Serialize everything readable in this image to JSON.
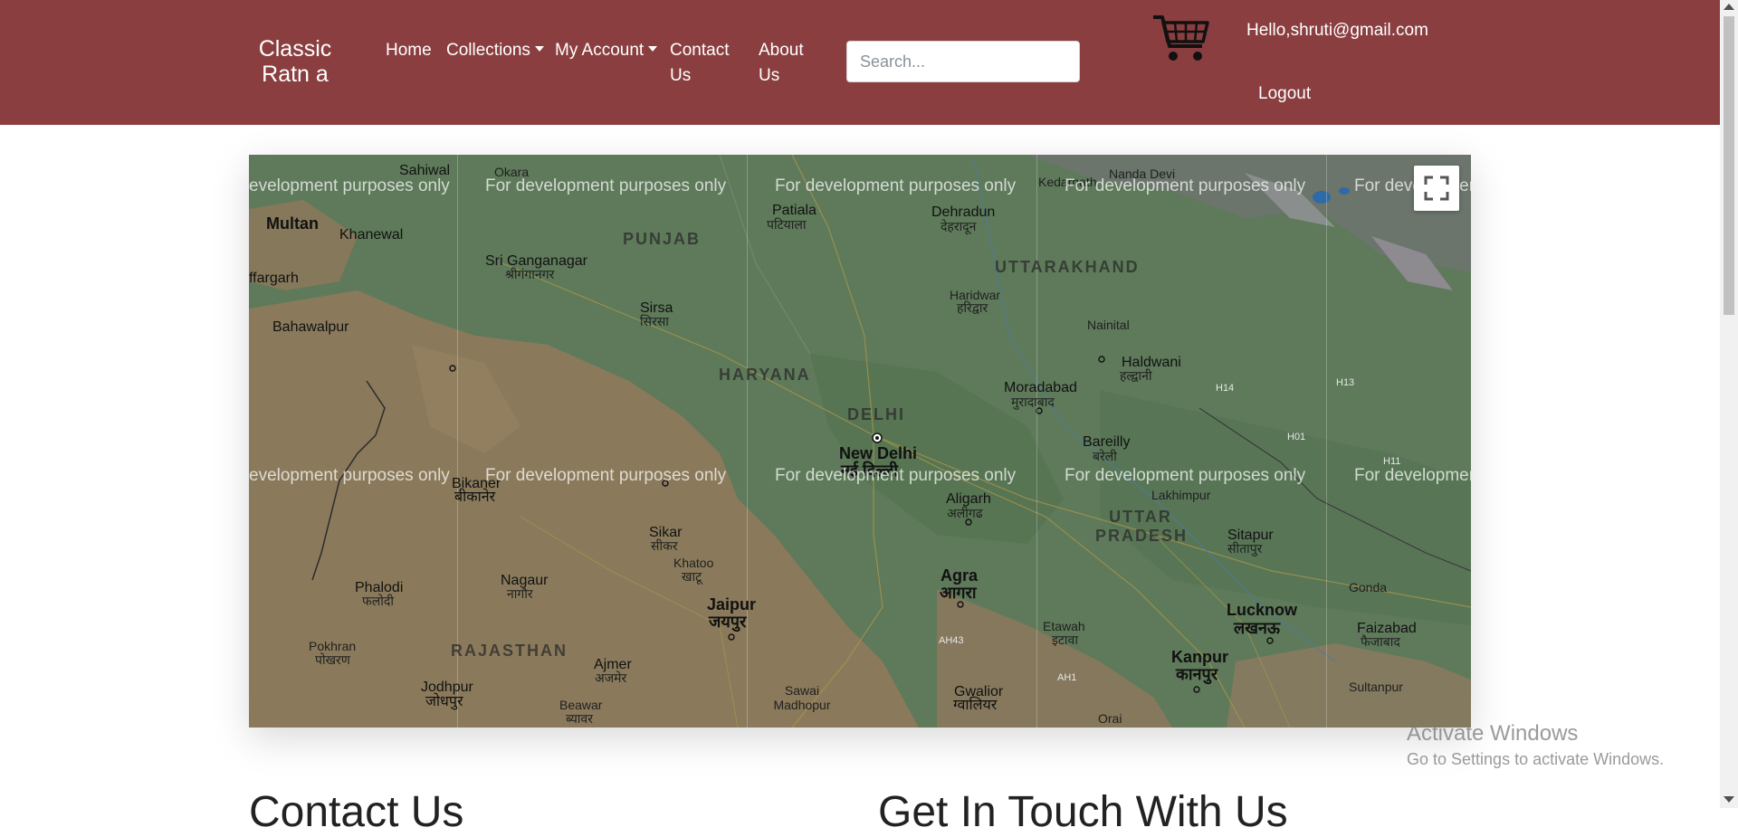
{
  "navbar": {
    "brand": "Classic Ratn a",
    "links": {
      "home": "Home",
      "collections": "Collections",
      "my_account": "My Account",
      "contact": "Contact Us",
      "about": "About Us"
    },
    "search_placeholder": "Search...",
    "greeting": "Hello,shruti@gmail.com",
    "logout": "Logout",
    "cart_icon": "shopping-cart-icon"
  },
  "map": {
    "watermark": "For development purposes only",
    "watermark_cut": "evelopment purposes only",
    "watermark_cut_right": "For developmer",
    "fullscreen_icon": "fullscreen-icon",
    "labels": {
      "sahiwal": "Sahiwal",
      "okara": "Okara",
      "multan": "Multan",
      "khanewal": "Khanewal",
      "muzaffargarh": "ffargarh",
      "bahawalpur": "Bahawalpur",
      "punjab": "PUNJAB",
      "patiala": "Patiala",
      "patiala_hi": "पटियाला",
      "sri_ganganagar": "Sri Ganganagar",
      "sri_ganganagar_hi": "श्रीगंगानगर",
      "sirsa": "Sirsa",
      "sirsa_hi": "सिरसा",
      "dehradun": "Dehradun",
      "dehradun_hi": "देहरादून",
      "uttarakhand": "UTTARAKHAND",
      "haridwar": "Haridwar",
      "haridwar_hi": "हरिद्वार",
      "nainital": "Nainital",
      "haldwani": "Haldwani",
      "haldwani_hi": "हल्द्वानी",
      "haryana": "HARYANA",
      "delhi": "DELHI",
      "new_delhi": "New Delhi",
      "new_delhi_hi": "नई दिल्ली",
      "moradabad": "Moradabad",
      "moradabad_hi": "मुरादाबाद",
      "bareilly": "Bareilly",
      "bareilly_hi": "बरेली",
      "bikaner": "Bikaner",
      "bikaner_hi": "बीकानेर",
      "aligarh": "Aligarh",
      "aligarh_hi": "अलीगढ",
      "uttar_pradesh": "UTTAR PRADESH",
      "lakhimpur": "Lakhimpur",
      "sitapur": "Sitapur",
      "sitapur_hi": "सीतापुर",
      "sikar": "Sikar",
      "sikar_hi": "सीकर",
      "khatoo": "Khatoo",
      "khatoo_hi": "खाटू",
      "phalodi": "Phalodi",
      "phalodi_hi": "फलोदी",
      "nagaur": "Nagaur",
      "nagaur_hi": "नागौर",
      "jaipur": "Jaipur",
      "jaipur_hi": "जयपुर",
      "agra": "Agra",
      "agra_hi": "आगरा",
      "lucknow": "Lucknow",
      "lucknow_hi": "लखनऊ",
      "gonda": "Gonda",
      "faizabad": "Faizabad",
      "faizabad_hi": "फैजाबाद",
      "rajasthan": "RAJASTHAN",
      "pokhran": "Pokhran",
      "pokhran_hi": "पोखरण",
      "ajmer": "Ajmer",
      "ajmer_hi": "अजमेर",
      "jodhpur": "Jodhpur",
      "jodhpur_hi": "जोधपुर",
      "beawar": "Beawar",
      "beawar_hi": "ब्यावर",
      "sawai_madhopur": "Sawai Madhopur",
      "etawah": "Etawah",
      "etawah_hi": "इटावा",
      "gwalior": "Gwalior",
      "gwalior_hi": "ग्वालियर",
      "kanpur": "Kanpur",
      "kanpur_hi": "कानपुर",
      "sultanpur": "Sultanpur",
      "orai": "Orai",
      "nanda_devi": "Nanda Devi",
      "kedarnath": "Kedarnath",
      "ah43": "AH43",
      "ah1": "AH1",
      "h14": "H14",
      "h13": "H13",
      "h01": "H01",
      "h11": "H11"
    }
  },
  "content": {
    "heading_left": "Contact Us",
    "heading_right": "Get In Touch With Us"
  },
  "os_overlay": {
    "activate_title": "Activate Windows",
    "activate_sub": "Go to Settings to activate Windows."
  },
  "colors": {
    "navbar_bg": "#8b3e3f",
    "map_green": "#5f7a5c",
    "map_tan": "#8a7a5e"
  }
}
